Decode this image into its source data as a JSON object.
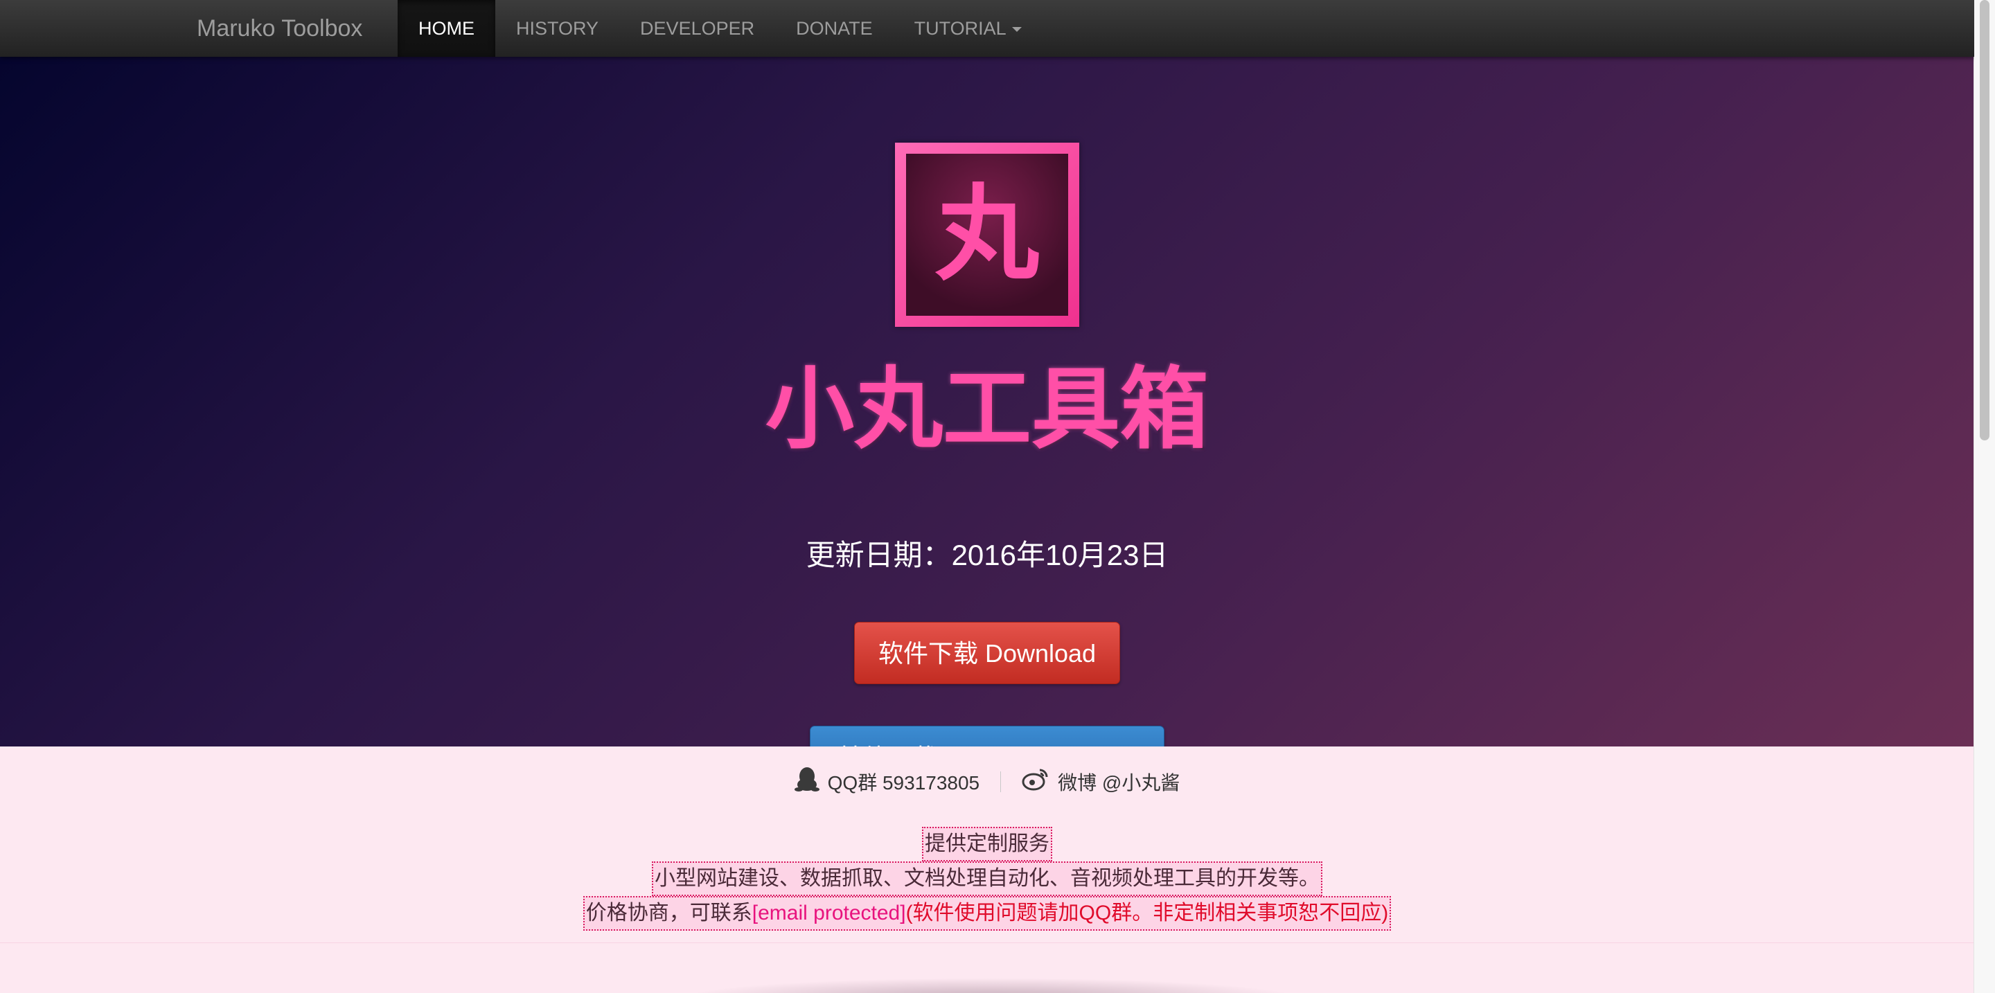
{
  "navbar": {
    "brand": "Maruko Toolbox",
    "items": [
      {
        "label": "HOME"
      },
      {
        "label": "HISTORY"
      },
      {
        "label": "DEVELOPER"
      },
      {
        "label": "DONATE"
      },
      {
        "label": "TUTORIAL"
      }
    ]
  },
  "hero": {
    "logo_glyph": "丸",
    "title": "小丸工具箱",
    "date": "更新日期：2016年10月23日",
    "download_label": "软件下载 Download",
    "other_label": "其他下载 Other Downloads"
  },
  "footer": {
    "qq": "QQ群 593173805",
    "weibo": "微博 @小丸酱",
    "custom_title": "提供定制服务",
    "custom_desc": "小型网站建设、数据抓取、文档处理自动化、音视频处理工具的开发等。",
    "contact_prefix": "价格协商，可联系",
    "email": "[email protected]",
    "contact_note": "(软件使用问题请加QQ群。非定制相关事项恕不回应)"
  },
  "colors": {
    "accent_pink": "#ff4fa7",
    "download_red": "#d9362d",
    "other_blue": "#2f7cc4",
    "footer_bg": "#fde8f1"
  }
}
